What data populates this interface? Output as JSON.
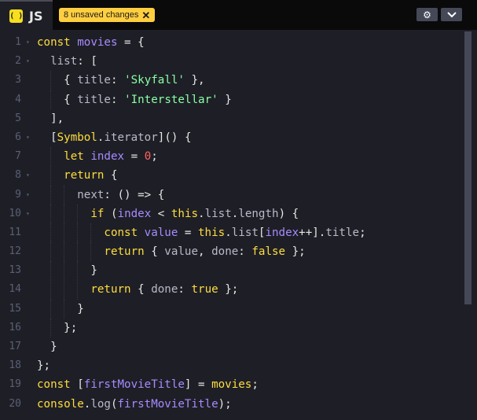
{
  "header": {
    "tab_label": "JS",
    "tab_icon": "( )",
    "unsaved_badge": "8 unsaved changes",
    "badge_close": "✕",
    "settings_icon": "⚙",
    "collapse_icon": "⌄"
  },
  "colors": {
    "keyword": "#ffdd40",
    "variable": "#a88aff",
    "string": "#88ffa4",
    "number": "#ff6363",
    "badge": "#ffcf40",
    "editor_bg": "#1e1f26"
  },
  "editor": {
    "language": "JavaScript",
    "lines": [
      {
        "n": "1",
        "fold": "▾",
        "indent": 0,
        "tokens": [
          [
            "kw",
            "const "
          ],
          [
            "vr",
            "movies"
          ],
          [
            "op",
            " = {"
          ]
        ]
      },
      {
        "n": "2",
        "fold": "▾",
        "indent": 1,
        "tokens": [
          [
            "pr",
            "list"
          ],
          [
            "op",
            ": ["
          ]
        ]
      },
      {
        "n": "3",
        "fold": "",
        "indent": 2,
        "tokens": [
          [
            "op",
            "{ "
          ],
          [
            "pr",
            "title"
          ],
          [
            "op",
            ": "
          ],
          [
            "st",
            "'Skyfall'"
          ],
          [
            "op",
            " },"
          ]
        ]
      },
      {
        "n": "4",
        "fold": "",
        "indent": 2,
        "tokens": [
          [
            "op",
            "{ "
          ],
          [
            "pr",
            "title"
          ],
          [
            "op",
            ": "
          ],
          [
            "st",
            "'Interstellar'"
          ],
          [
            "op",
            " }"
          ]
        ]
      },
      {
        "n": "5",
        "fold": "",
        "indent": 1,
        "tokens": [
          [
            "op",
            "],"
          ]
        ]
      },
      {
        "n": "6",
        "fold": "▾",
        "indent": 1,
        "tokens": [
          [
            "op",
            "["
          ],
          [
            "kw",
            "Symbol"
          ],
          [
            "op",
            "."
          ],
          [
            "pr",
            "iterator"
          ],
          [
            "op",
            "]() {"
          ]
        ]
      },
      {
        "n": "7",
        "fold": "",
        "indent": 2,
        "tokens": [
          [
            "kw",
            "let "
          ],
          [
            "vr",
            "index"
          ],
          [
            "op",
            " = "
          ],
          [
            "nm",
            "0"
          ],
          [
            "op",
            ";"
          ]
        ]
      },
      {
        "n": "8",
        "fold": "▾",
        "indent": 2,
        "tokens": [
          [
            "kw",
            "return"
          ],
          [
            "op",
            " {"
          ]
        ]
      },
      {
        "n": "9",
        "fold": "▾",
        "indent": 3,
        "tokens": [
          [
            "pr",
            "next"
          ],
          [
            "op",
            ": () => {"
          ]
        ]
      },
      {
        "n": "10",
        "fold": "▾",
        "indent": 4,
        "tokens": [
          [
            "kw",
            "if"
          ],
          [
            "op",
            " ("
          ],
          [
            "vr",
            "index"
          ],
          [
            "op",
            " < "
          ],
          [
            "kw",
            "this"
          ],
          [
            "op",
            "."
          ],
          [
            "pr",
            "list"
          ],
          [
            "op",
            "."
          ],
          [
            "pr",
            "length"
          ],
          [
            "op",
            ") {"
          ]
        ]
      },
      {
        "n": "11",
        "fold": "",
        "indent": 5,
        "tokens": [
          [
            "kw",
            "const "
          ],
          [
            "vr",
            "value"
          ],
          [
            "op",
            " = "
          ],
          [
            "kw",
            "this"
          ],
          [
            "op",
            "."
          ],
          [
            "pr",
            "list"
          ],
          [
            "op",
            "["
          ],
          [
            "vr",
            "index"
          ],
          [
            "op",
            "++]."
          ],
          [
            "pr",
            "title"
          ],
          [
            "op",
            ";"
          ]
        ]
      },
      {
        "n": "12",
        "fold": "",
        "indent": 5,
        "tokens": [
          [
            "kw",
            "return"
          ],
          [
            "op",
            " { "
          ],
          [
            "pr",
            "value"
          ],
          [
            "op",
            ", "
          ],
          [
            "pr",
            "done"
          ],
          [
            "op",
            ": "
          ],
          [
            "kw",
            "false"
          ],
          [
            "op",
            " };"
          ]
        ]
      },
      {
        "n": "13",
        "fold": "",
        "indent": 4,
        "tokens": [
          [
            "op",
            "}"
          ]
        ]
      },
      {
        "n": "14",
        "fold": "",
        "indent": 4,
        "tokens": [
          [
            "kw",
            "return"
          ],
          [
            "op",
            " { "
          ],
          [
            "pr",
            "done"
          ],
          [
            "op",
            ": "
          ],
          [
            "kw",
            "true"
          ],
          [
            "op",
            " };"
          ]
        ]
      },
      {
        "n": "15",
        "fold": "",
        "indent": 3,
        "tokens": [
          [
            "op",
            "}"
          ]
        ]
      },
      {
        "n": "16",
        "fold": "",
        "indent": 2,
        "tokens": [
          [
            "op",
            "};"
          ]
        ]
      },
      {
        "n": "17",
        "fold": "",
        "indent": 1,
        "tokens": [
          [
            "op",
            "}"
          ]
        ]
      },
      {
        "n": "18",
        "fold": "",
        "indent": 0,
        "tokens": [
          [
            "op",
            "};"
          ]
        ]
      },
      {
        "n": "19",
        "fold": "",
        "indent": 0,
        "tokens": [
          [
            "kw",
            "const "
          ],
          [
            "op",
            "["
          ],
          [
            "vr",
            "firstMovieTitle"
          ],
          [
            "op",
            "] = "
          ],
          [
            "kw",
            "movies"
          ],
          [
            "op",
            ";"
          ]
        ]
      },
      {
        "n": "20",
        "fold": "",
        "indent": 0,
        "tokens": [
          [
            "kw",
            "console"
          ],
          [
            "op",
            "."
          ],
          [
            "pr",
            "log"
          ],
          [
            "op",
            "("
          ],
          [
            "vr",
            "firstMovieTitle"
          ],
          [
            "op",
            ");"
          ]
        ]
      }
    ]
  }
}
